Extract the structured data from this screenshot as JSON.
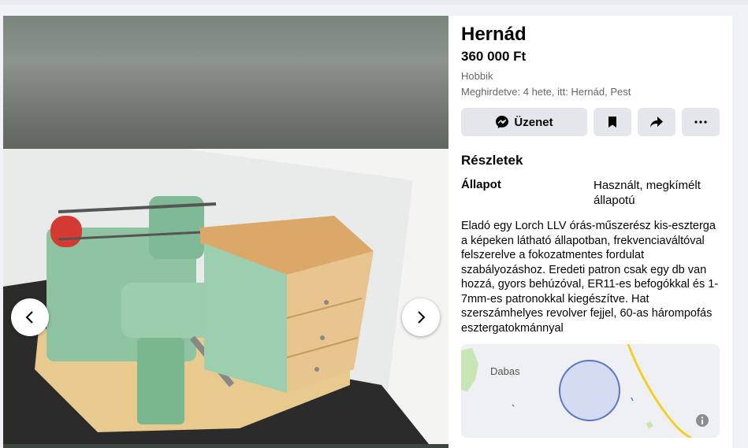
{
  "listing": {
    "title": "Hernád",
    "price": "360 000 Ft",
    "category": "Hobbik",
    "posted": "Meghirdetve: 4 hete, itt: Hernád, Pest"
  },
  "actions": {
    "message_label": "Üzenet"
  },
  "details": {
    "heading": "Részletek",
    "condition_label": "Állapot",
    "condition_value": "Használt, megkímélt állapotú",
    "description": "Eladó egy Lorch LLV órás-műszerész kis-esztergа a képeken látható állapotban, frekvenciaváltóval felszerelve a fokozatmentes fordulat szabályozáshoz. Eredeti patron csak egy db van hozzá, gyors behúzóval, ER11-es befogókkal és 1-7mm-es patronokkal kiegészítve. Hat szerszámhelyes revolver fejjel, 60-as hárompofás esztergatokmánnyal"
  },
  "map": {
    "place_label": "Dabas"
  },
  "colors": {
    "button_bg": "#e4e6eb",
    "map_circle": "#5b74c7",
    "map_road": "#f2d024"
  }
}
